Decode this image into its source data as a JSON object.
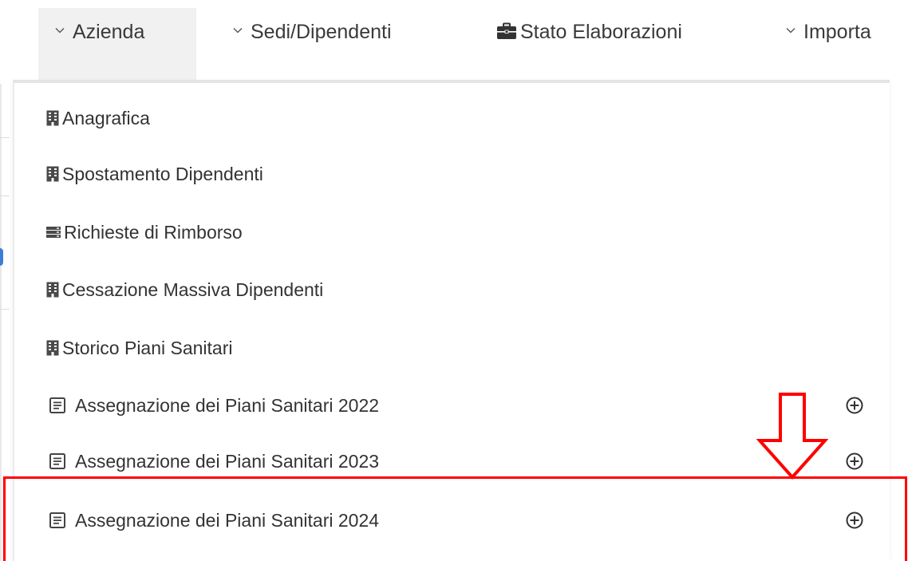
{
  "nav": {
    "tabs": [
      {
        "label": "Azienda",
        "icon": "chevron-down-icon"
      },
      {
        "label": "Sedi/Dipendenti",
        "icon": "chevron-down-icon"
      },
      {
        "label": "Stato Elaborazioni",
        "icon": "briefcase-icon"
      },
      {
        "label": "Importa",
        "icon": "chevron-down-icon"
      }
    ]
  },
  "dropdown": {
    "items": [
      {
        "label": "Anagrafica",
        "icon": "building-icon"
      },
      {
        "label": "Spostamento Dipendenti",
        "icon": "building-icon"
      },
      {
        "label": "Richieste di Rimborso",
        "icon": "server-icon"
      },
      {
        "label": "Cessazione Massiva Dipendenti",
        "icon": "building-icon"
      },
      {
        "label": "Storico Piani Sanitari",
        "icon": "building-icon"
      },
      {
        "label": "Assegnazione dei Piani Sanitari 2022",
        "icon": "list-alt-icon",
        "action_icon": "plus-circle-icon"
      },
      {
        "label": "Assegnazione dei Piani Sanitari 2023",
        "icon": "list-alt-icon",
        "action_icon": "plus-circle-icon"
      },
      {
        "label": "Assegnazione dei Piani Sanitari 2024",
        "icon": "list-alt-icon",
        "action_icon": "plus-circle-icon"
      }
    ]
  },
  "annotations": {
    "arrow": "arrow-down-icon",
    "highlight_target": "Assegnazione dei Piani Sanitari 2024"
  },
  "colors": {
    "highlight": "#ff0000",
    "active_tab_bg": "#f1f1f1",
    "text": "#333333"
  }
}
